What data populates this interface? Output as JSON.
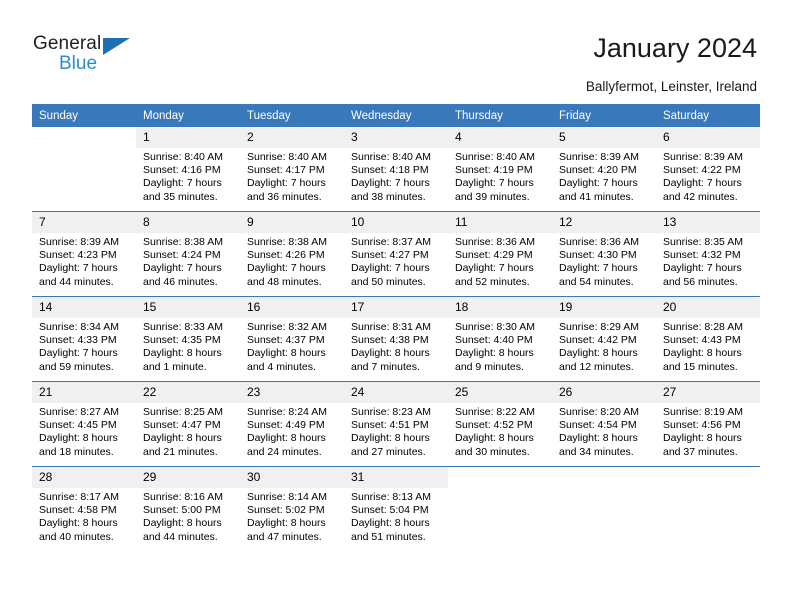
{
  "brand": {
    "name_part1": "General",
    "name_part2": "Blue",
    "triangle_icon": "triangle-icon",
    "accent_color": "#2e8bd0",
    "triangle_color": "#1f6fb5"
  },
  "header": {
    "title": "January 2024",
    "location": "Ballyfermot, Leinster, Ireland"
  },
  "calendar": {
    "header_color": "#3a78bc",
    "daynum_band_color": "#f0f0f0",
    "weekday_headers": [
      "Sunday",
      "Monday",
      "Tuesday",
      "Wednesday",
      "Thursday",
      "Friday",
      "Saturday"
    ],
    "weeks": [
      [
        {
          "day": "",
          "lines": []
        },
        {
          "day": "1",
          "lines": [
            "Sunrise: 8:40 AM",
            "Sunset: 4:16 PM",
            "Daylight: 7 hours",
            "and 35 minutes."
          ]
        },
        {
          "day": "2",
          "lines": [
            "Sunrise: 8:40 AM",
            "Sunset: 4:17 PM",
            "Daylight: 7 hours",
            "and 36 minutes."
          ]
        },
        {
          "day": "3",
          "lines": [
            "Sunrise: 8:40 AM",
            "Sunset: 4:18 PM",
            "Daylight: 7 hours",
            "and 38 minutes."
          ]
        },
        {
          "day": "4",
          "lines": [
            "Sunrise: 8:40 AM",
            "Sunset: 4:19 PM",
            "Daylight: 7 hours",
            "and 39 minutes."
          ]
        },
        {
          "day": "5",
          "lines": [
            "Sunrise: 8:39 AM",
            "Sunset: 4:20 PM",
            "Daylight: 7 hours",
            "and 41 minutes."
          ]
        },
        {
          "day": "6",
          "lines": [
            "Sunrise: 8:39 AM",
            "Sunset: 4:22 PM",
            "Daylight: 7 hours",
            "and 42 minutes."
          ]
        }
      ],
      [
        {
          "day": "7",
          "lines": [
            "Sunrise: 8:39 AM",
            "Sunset: 4:23 PM",
            "Daylight: 7 hours",
            "and 44 minutes."
          ]
        },
        {
          "day": "8",
          "lines": [
            "Sunrise: 8:38 AM",
            "Sunset: 4:24 PM",
            "Daylight: 7 hours",
            "and 46 minutes."
          ]
        },
        {
          "day": "9",
          "lines": [
            "Sunrise: 8:38 AM",
            "Sunset: 4:26 PM",
            "Daylight: 7 hours",
            "and 48 minutes."
          ]
        },
        {
          "day": "10",
          "lines": [
            "Sunrise: 8:37 AM",
            "Sunset: 4:27 PM",
            "Daylight: 7 hours",
            "and 50 minutes."
          ]
        },
        {
          "day": "11",
          "lines": [
            "Sunrise: 8:36 AM",
            "Sunset: 4:29 PM",
            "Daylight: 7 hours",
            "and 52 minutes."
          ]
        },
        {
          "day": "12",
          "lines": [
            "Sunrise: 8:36 AM",
            "Sunset: 4:30 PM",
            "Daylight: 7 hours",
            "and 54 minutes."
          ]
        },
        {
          "day": "13",
          "lines": [
            "Sunrise: 8:35 AM",
            "Sunset: 4:32 PM",
            "Daylight: 7 hours",
            "and 56 minutes."
          ]
        }
      ],
      [
        {
          "day": "14",
          "lines": [
            "Sunrise: 8:34 AM",
            "Sunset: 4:33 PM",
            "Daylight: 7 hours",
            "and 59 minutes."
          ]
        },
        {
          "day": "15",
          "lines": [
            "Sunrise: 8:33 AM",
            "Sunset: 4:35 PM",
            "Daylight: 8 hours",
            "and 1 minute."
          ]
        },
        {
          "day": "16",
          "lines": [
            "Sunrise: 8:32 AM",
            "Sunset: 4:37 PM",
            "Daylight: 8 hours",
            "and 4 minutes."
          ]
        },
        {
          "day": "17",
          "lines": [
            "Sunrise: 8:31 AM",
            "Sunset: 4:38 PM",
            "Daylight: 8 hours",
            "and 7 minutes."
          ]
        },
        {
          "day": "18",
          "lines": [
            "Sunrise: 8:30 AM",
            "Sunset: 4:40 PM",
            "Daylight: 8 hours",
            "and 9 minutes."
          ]
        },
        {
          "day": "19",
          "lines": [
            "Sunrise: 8:29 AM",
            "Sunset: 4:42 PM",
            "Daylight: 8 hours",
            "and 12 minutes."
          ]
        },
        {
          "day": "20",
          "lines": [
            "Sunrise: 8:28 AM",
            "Sunset: 4:43 PM",
            "Daylight: 8 hours",
            "and 15 minutes."
          ]
        }
      ],
      [
        {
          "day": "21",
          "lines": [
            "Sunrise: 8:27 AM",
            "Sunset: 4:45 PM",
            "Daylight: 8 hours",
            "and 18 minutes."
          ]
        },
        {
          "day": "22",
          "lines": [
            "Sunrise: 8:25 AM",
            "Sunset: 4:47 PM",
            "Daylight: 8 hours",
            "and 21 minutes."
          ]
        },
        {
          "day": "23",
          "lines": [
            "Sunrise: 8:24 AM",
            "Sunset: 4:49 PM",
            "Daylight: 8 hours",
            "and 24 minutes."
          ]
        },
        {
          "day": "24",
          "lines": [
            "Sunrise: 8:23 AM",
            "Sunset: 4:51 PM",
            "Daylight: 8 hours",
            "and 27 minutes."
          ]
        },
        {
          "day": "25",
          "lines": [
            "Sunrise: 8:22 AM",
            "Sunset: 4:52 PM",
            "Daylight: 8 hours",
            "and 30 minutes."
          ]
        },
        {
          "day": "26",
          "lines": [
            "Sunrise: 8:20 AM",
            "Sunset: 4:54 PM",
            "Daylight: 8 hours",
            "and 34 minutes."
          ]
        },
        {
          "day": "27",
          "lines": [
            "Sunrise: 8:19 AM",
            "Sunset: 4:56 PM",
            "Daylight: 8 hours",
            "and 37 minutes."
          ]
        }
      ],
      [
        {
          "day": "28",
          "lines": [
            "Sunrise: 8:17 AM",
            "Sunset: 4:58 PM",
            "Daylight: 8 hours",
            "and 40 minutes."
          ]
        },
        {
          "day": "29",
          "lines": [
            "Sunrise: 8:16 AM",
            "Sunset: 5:00 PM",
            "Daylight: 8 hours",
            "and 44 minutes."
          ]
        },
        {
          "day": "30",
          "lines": [
            "Sunrise: 8:14 AM",
            "Sunset: 5:02 PM",
            "Daylight: 8 hours",
            "and 47 minutes."
          ]
        },
        {
          "day": "31",
          "lines": [
            "Sunrise: 8:13 AM",
            "Sunset: 5:04 PM",
            "Daylight: 8 hours",
            "and 51 minutes."
          ]
        },
        {
          "day": "",
          "lines": []
        },
        {
          "day": "",
          "lines": []
        },
        {
          "day": "",
          "lines": []
        }
      ]
    ]
  }
}
